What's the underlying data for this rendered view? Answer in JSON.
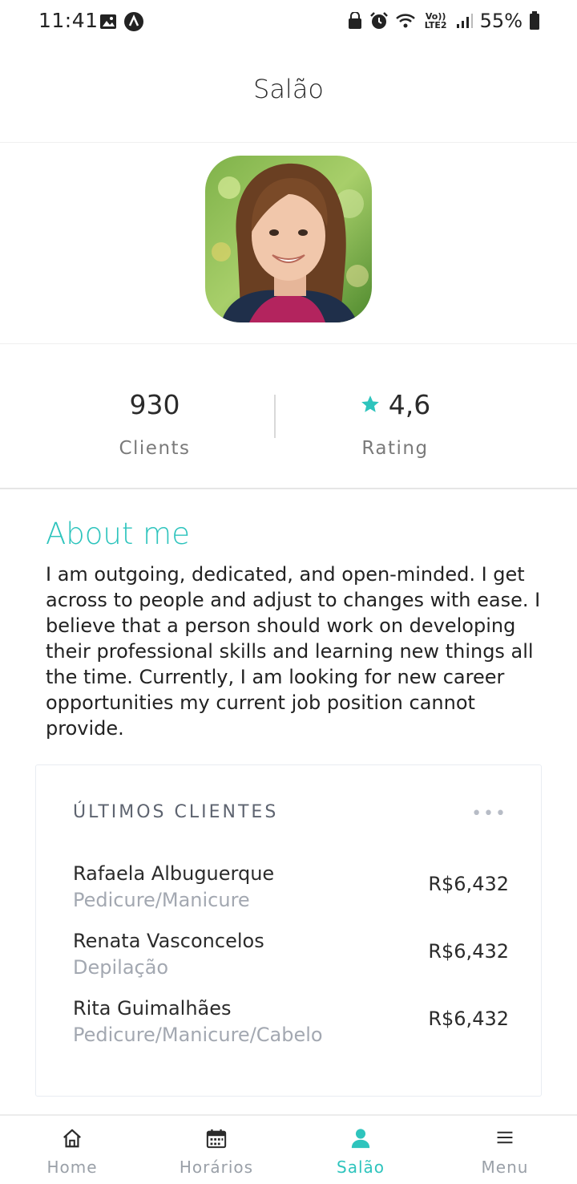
{
  "status_bar": {
    "time": "11:41",
    "battery": "55%",
    "network": "Vo)) LTE2"
  },
  "header": {
    "title": "Salão"
  },
  "profile": {
    "avatar_icon": "profile-photo"
  },
  "stats": {
    "clients_value": "930",
    "clients_label": "Clients",
    "rating_value": "4,6",
    "rating_label": "Rating"
  },
  "about": {
    "title": "About me",
    "text": "I am outgoing, dedicated, and open-minded. I get across to people and adjust to changes with ease. I believe that a person should work on developing their professional skills and learning new things all the time. Currently, I am looking for new career opportunities my current job position cannot provide."
  },
  "recent_clients": {
    "title": "ÚLTIMOS CLIENTES",
    "more": "•••",
    "items": [
      {
        "name": "Rafaela Albuguerque",
        "service": "Pedicure/Manicure",
        "amount": "R$6,432"
      },
      {
        "name": "Renata Vasconcelos",
        "service": "Depilação",
        "amount": "R$6,432"
      },
      {
        "name": "Rita Guimalhães",
        "service": "Pedicure/Manicure/Cabelo",
        "amount": "R$6,432"
      }
    ]
  },
  "nav": {
    "items": [
      {
        "label": "Home",
        "icon": "home-icon"
      },
      {
        "label": "Horários",
        "icon": "calendar-icon"
      },
      {
        "label": "Salão",
        "icon": "person-icon",
        "active": true
      },
      {
        "label": "Menu",
        "icon": "menu-icon"
      }
    ]
  },
  "colors": {
    "accent": "#2ec4bd",
    "muted": "#a3a8b1"
  }
}
